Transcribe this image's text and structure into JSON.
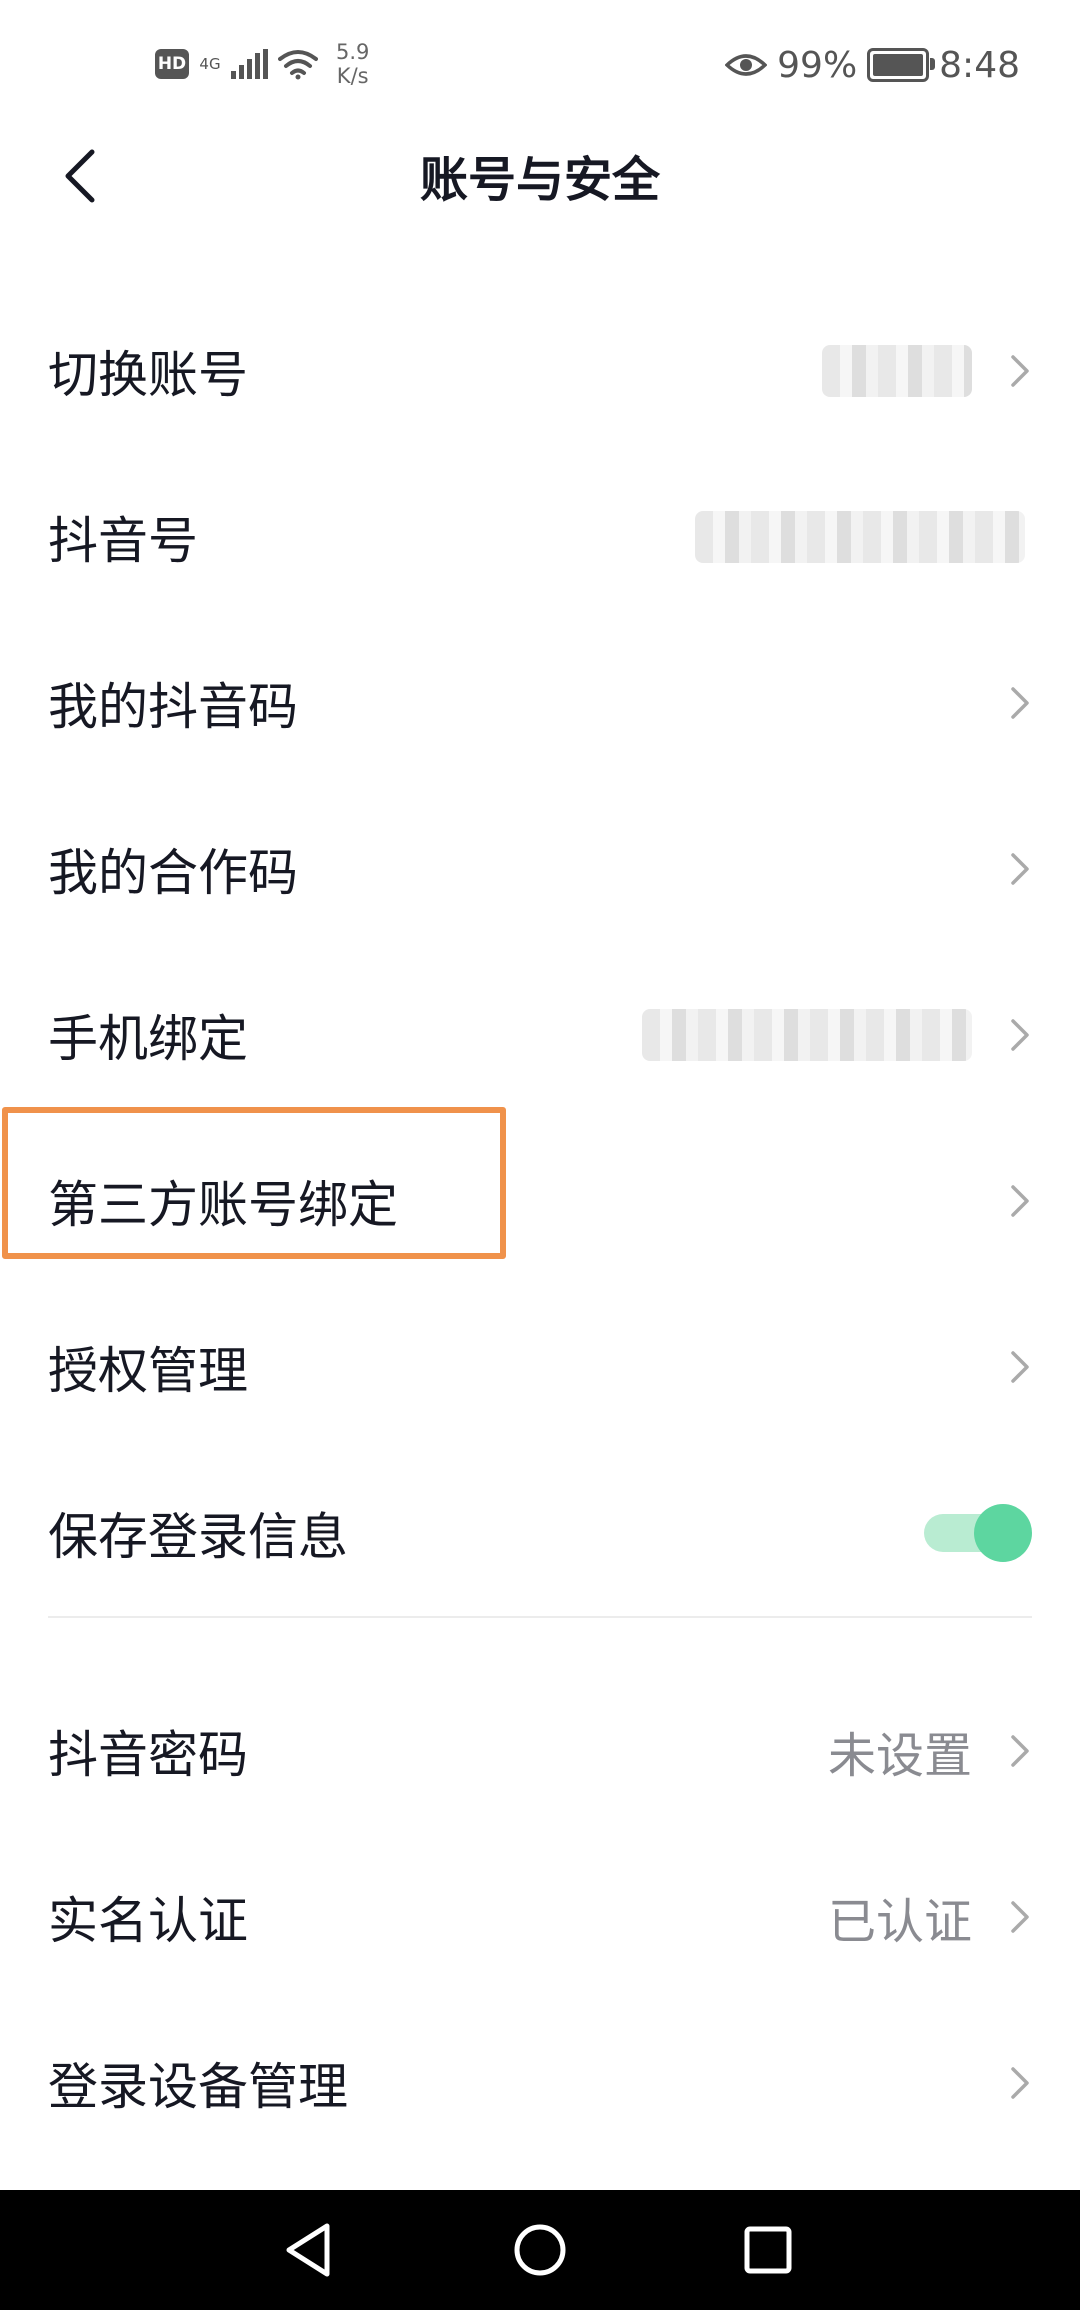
{
  "status_bar": {
    "hd": "HD",
    "network": "4G",
    "speed_value": "5.9",
    "speed_unit": "K/s",
    "battery": "99%",
    "time": "8:48"
  },
  "header": {
    "title": "账号与安全"
  },
  "settings": {
    "switch_account": {
      "label": "切换账号"
    },
    "douyin_id": {
      "label": "抖音号"
    },
    "my_douyin_code": {
      "label": "我的抖音码"
    },
    "my_coop_code": {
      "label": "我的合作码"
    },
    "phone_binding": {
      "label": "手机绑定"
    },
    "third_party_binding": {
      "label": "第三方账号绑定"
    },
    "auth_management": {
      "label": "授权管理"
    },
    "save_login_info": {
      "label": "保存登录信息",
      "enabled": true
    },
    "douyin_password": {
      "label": "抖音密码",
      "value": "未设置"
    },
    "real_name": {
      "label": "实名认证",
      "value": "已认证"
    },
    "device_management": {
      "label": "登录设备管理"
    }
  },
  "colors": {
    "highlight_border": "#f0924b",
    "toggle_on": "#5dd6a0",
    "toggle_track": "#b9ecd2",
    "text_primary": "#161823",
    "text_secondary": "#8a8b91"
  },
  "icons": {
    "back": "chevron-left-icon",
    "row_arrow": "chevron-right-icon",
    "eye": "eye-icon",
    "wifi": "wifi-icon",
    "nav_back": "triangle-back-icon",
    "nav_home": "circle-home-icon",
    "nav_recent": "square-recent-icon"
  }
}
